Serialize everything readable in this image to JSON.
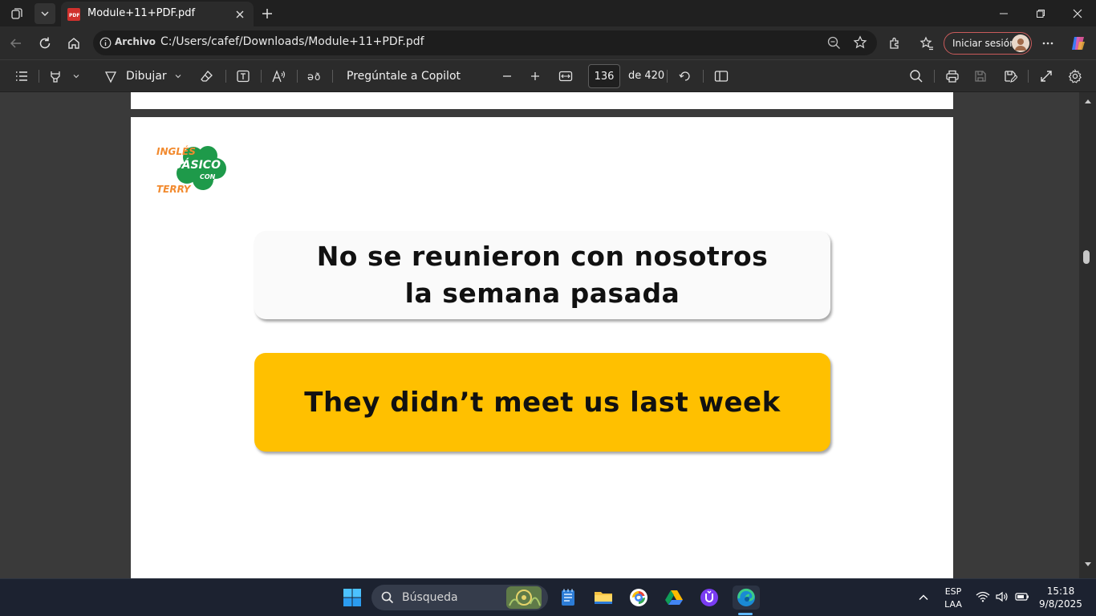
{
  "browser": {
    "tab_title": "Module+11+PDF.pdf",
    "address_label": "Archivo",
    "address_url": "C:/Users/cafef/Downloads/Module+11+PDF.pdf",
    "signin_label": "Iniciar sesión"
  },
  "pdf_toolbar": {
    "draw_label": "Dibujar",
    "copilot_label": "Pregúntale a Copilot",
    "page_number": "136",
    "page_total": "de 420"
  },
  "page_content": {
    "logo_text_top": "INGLÉS",
    "logo_text_main": "BÁSICO",
    "logo_text_con": "CON",
    "logo_text_bottom": "TERRY",
    "card1_line1": "No se reunieron con nosotros",
    "card1_line2": "la semana pasada",
    "card2_text": "They didn’t meet us last week",
    "colors": {
      "card2_bg": "#ffc000",
      "logo_green": "#1e9a4a",
      "logo_orange": "#f28a2e"
    }
  },
  "taskbar": {
    "search_placeholder": "Búsqueda",
    "language_top": "ESP",
    "language_bottom": "LAA",
    "time": "15:18",
    "date": "9/8/2025"
  }
}
